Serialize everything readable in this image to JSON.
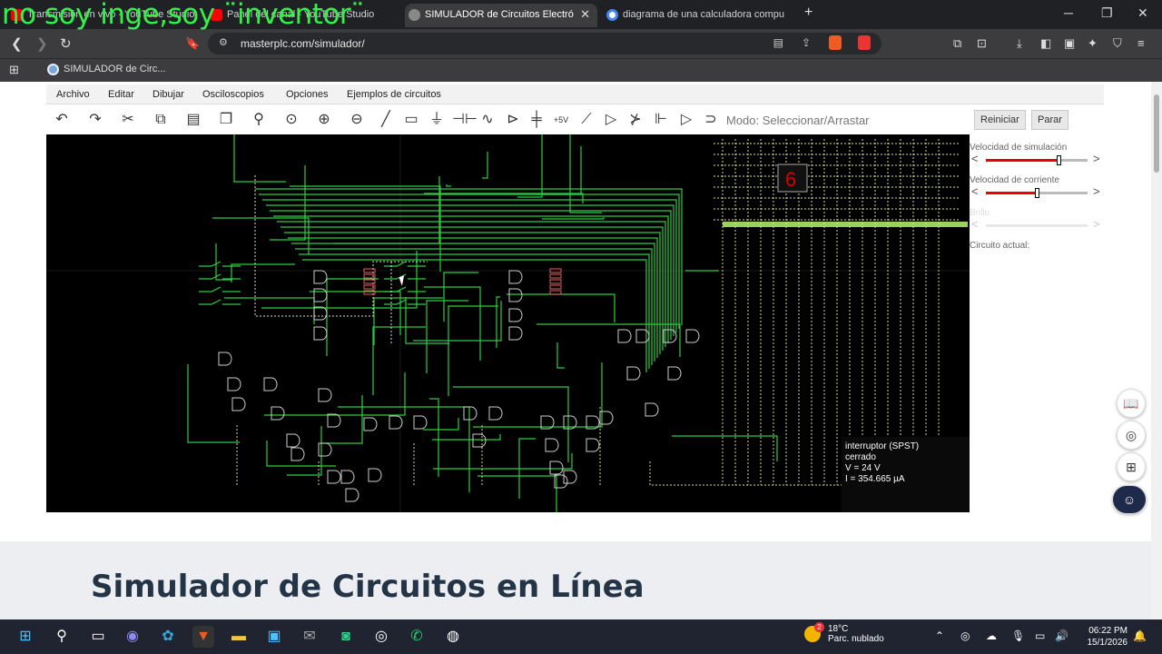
{
  "overlay_text": "no soy inge,soy ¨inventor¨",
  "tabs": [
    {
      "label": "Transmisión en vivo - YouTube Studio",
      "active": false
    },
    {
      "label": "Panel del canal - YouTube Studio",
      "active": false
    },
    {
      "label": "SIMULADOR de Circuitos Electró",
      "active": true
    },
    {
      "label": "diagrama de una calculadora compu",
      "active": false
    }
  ],
  "url": "masterplc.com/simulador/",
  "bookmark": "SIMULADOR de Circ...",
  "menu": [
    "Archivo",
    "Editar",
    "Dibujar",
    "Osciloscopios",
    "Opciones",
    "Ejemplos de circuitos"
  ],
  "mode_text": "Modo: Seleccionar/Arrastar",
  "toolbar_icons": [
    "undo-icon",
    "redo-icon",
    "scissors-icon",
    "copy-icon",
    "paste-icon",
    "duplicate-icon",
    "zoom-icon",
    "zoom-fit-icon",
    "zoom-in-icon",
    "zoom-out-icon",
    "wire-icon",
    "resistor-icon",
    "ground-icon",
    "capacitor-icon",
    "inductor-icon",
    "diode-icon",
    "battery-icon",
    "voltage-source-icon",
    "switch-icon",
    "buffer-icon",
    "transistor-icon",
    "mosfet-icon",
    "inverter-icon",
    "and-gate-icon"
  ],
  "side": {
    "reset_label": "Reiniciar",
    "stop_label": "Parar",
    "sim_speed_label": "Velocidad de simulación",
    "sim_speed": 0.71,
    "current_speed_label": "Velocidad de corriente",
    "current_speed": 0.5,
    "brightness_label": "Brillo",
    "current_circuit_label": "Circuito actual:"
  },
  "display_digit": "6",
  "info": {
    "line1": "interruptor (SPST)",
    "line2": "cerrado",
    "line3": "V = 24 V",
    "line4": "I = 354.665 µA"
  },
  "page_heading": "Simulador de Circuitos en Línea",
  "taskbar": {
    "weather_temp": "18°C",
    "weather_desc": "Parc. nublado",
    "time": "06:22 PM",
    "date": "15/1/2026",
    "weather_badge": "2"
  },
  "colors": {
    "accent": "#35f04a",
    "canvas": "#000000",
    "wire": "#2ecc40",
    "slider": "#e00000"
  }
}
